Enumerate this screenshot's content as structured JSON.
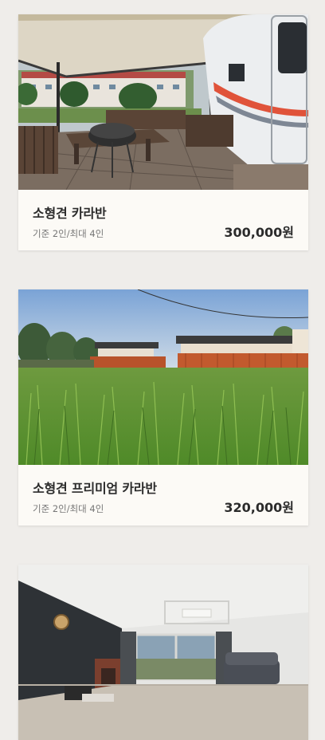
{
  "listings": [
    {
      "name": "소형견 카라반",
      "capacity": "기준 2인/최대 4인",
      "price": "300,000원",
      "photo": "caravan-deck-photo"
    },
    {
      "name": "소형견 프리미엄 카라반",
      "capacity": "기준 2인/최대 4인",
      "price": "320,000원",
      "photo": "lawn-caravans-photo"
    },
    {
      "name": "",
      "capacity": "",
      "price": "",
      "photo": "room-interior-photo"
    }
  ]
}
